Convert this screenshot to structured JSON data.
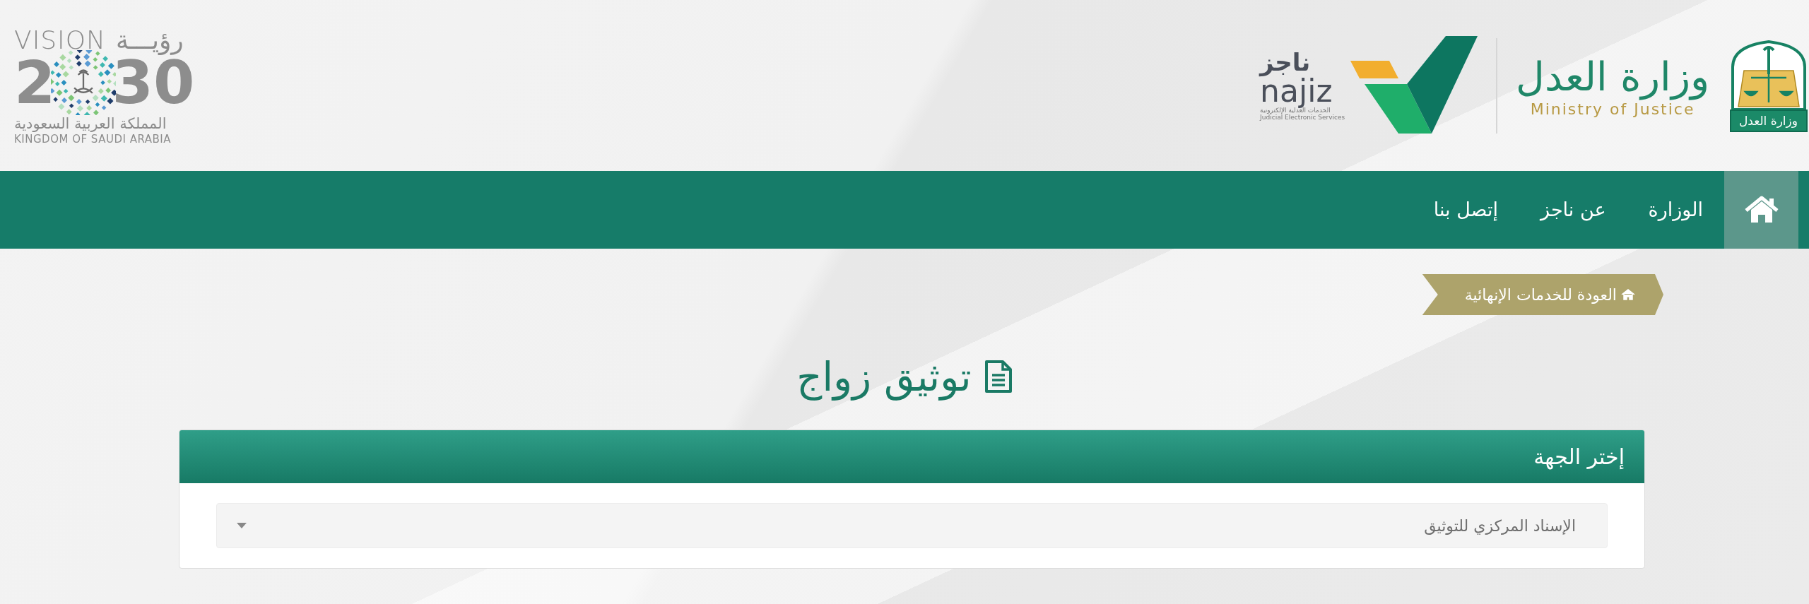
{
  "header": {
    "vision_logo": {
      "vision": "VISION",
      "ruya": "رؤيـــة",
      "year_start": "2",
      "year_end": "30",
      "kingdom_ar": "المملكة العربية السعودية",
      "kingdom_en": "KINGDOM OF SAUDI ARABIA"
    },
    "najiz_logo": {
      "name_ar": "ناجز",
      "name_en": "najiz",
      "tagline_ar": "الخدمات العدلية الإلكترونية",
      "tagline_en": "Judicial Electronic Services"
    },
    "ministry_logo": {
      "name_ar": "وزارة العدل",
      "name_en": "Ministry of Justice",
      "emblem_caption": "وزارة العدل"
    }
  },
  "nav": {
    "items": [
      {
        "kind": "home",
        "selected": true
      },
      {
        "kind": "link",
        "label": "الوزارة",
        "selected": false
      },
      {
        "kind": "link",
        "label": "عن ناجز",
        "selected": false
      },
      {
        "kind": "link",
        "label": "إتصل بنا",
        "selected": false
      }
    ]
  },
  "breadcrumb": {
    "label": "العودة للخدمات الإنهائية"
  },
  "page_title": "توثيق زواج",
  "panel": {
    "title": "إختر الجهة",
    "select": {
      "value": "الإسناد المركزي للتوثيق"
    }
  }
}
